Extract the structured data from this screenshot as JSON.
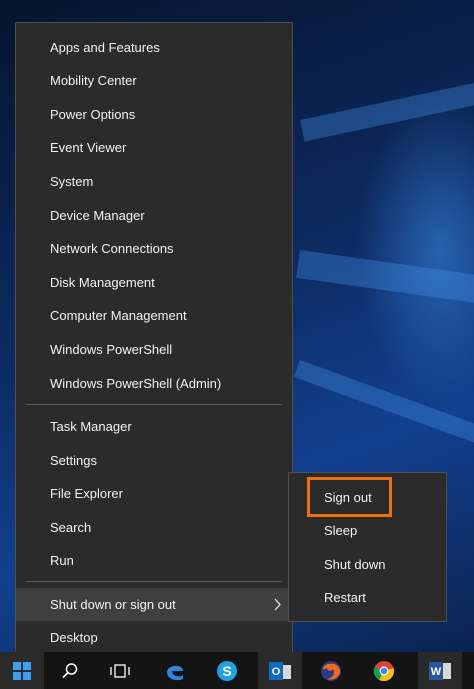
{
  "context_menu": {
    "items": [
      {
        "label": "Apps and Features"
      },
      {
        "label": "Mobility Center"
      },
      {
        "label": "Power Options"
      },
      {
        "label": "Event Viewer"
      },
      {
        "label": "System"
      },
      {
        "label": "Device Manager"
      },
      {
        "label": "Network Connections"
      },
      {
        "label": "Disk Management"
      },
      {
        "label": "Computer Management"
      },
      {
        "label": "Windows PowerShell"
      },
      {
        "label": "Windows PowerShell (Admin)"
      },
      {
        "label": "Task Manager"
      },
      {
        "label": "Settings"
      },
      {
        "label": "File Explorer"
      },
      {
        "label": "Search"
      },
      {
        "label": "Run"
      },
      {
        "label": "Shut down or sign out",
        "has_submenu": true,
        "highlighted": true
      },
      {
        "label": "Desktop"
      }
    ]
  },
  "submenu": {
    "items": [
      {
        "label": "Sign out",
        "focused": true
      },
      {
        "label": "Sleep"
      },
      {
        "label": "Shut down"
      },
      {
        "label": "Restart"
      }
    ]
  },
  "taskbar": {
    "icons": [
      "windows-start-icon",
      "search-icon",
      "task-view-icon",
      "edge-icon",
      "skype-icon",
      "outlook-icon",
      "firefox-icon",
      "chrome-icon",
      "word-icon"
    ]
  },
  "colors": {
    "menu_bg": "#2b2b2b",
    "menu_text": "#f2f2f2",
    "highlight": "#3f3f3f",
    "focus_outline": "#f07010",
    "taskbar": "#141414"
  }
}
